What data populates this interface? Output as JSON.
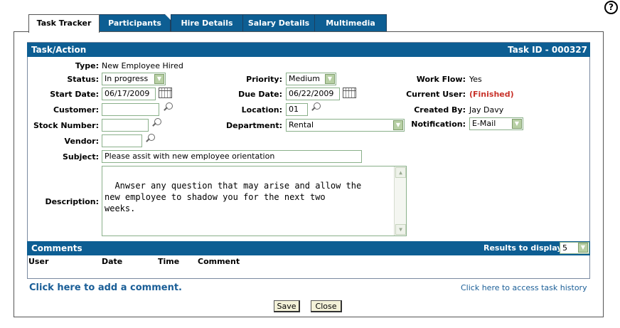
{
  "help": {
    "icon": "question-circle-icon",
    "glyph": "?"
  },
  "tabs": [
    {
      "label": "Task Tracker",
      "active": true
    },
    {
      "label": "Participants"
    },
    {
      "label": "Hire Details"
    },
    {
      "label": "Salary Details"
    },
    {
      "label": "Multimedia"
    }
  ],
  "task": {
    "header": "Task/Action",
    "task_id": "Task ID - 000327",
    "type_label": "Type:",
    "type_value": "New Employee Hired",
    "status_label": "Status:",
    "status_value": "In progress",
    "start_label": "Start Date:",
    "start_value": "06/17/2009",
    "customer_label": "Customer:",
    "customer_value": "",
    "stock_label": "Stock Number:",
    "stock_value": "",
    "vendor_label": "Vendor:",
    "vendor_value": "",
    "subject_label": "Subject:",
    "subject_value": "Please assit with new employee orientation",
    "description_label": "Description:",
    "description_value": "Anwser any question that may arise and allow the\nnew employee to shadow you for the next two\nweeks.",
    "priority_label": "Priority:",
    "priority_value": "Medium",
    "due_label": "Due Date:",
    "due_value": "06/22/2009",
    "location_label": "Location:",
    "location_value": "01",
    "department_label": "Department:",
    "department_value": "Rental",
    "workflow_label": "Work Flow:",
    "workflow_value": "Yes",
    "current_user_label": "Current User:",
    "current_user_value": "(Finished)",
    "created_by_label": "Created By:",
    "created_by_value": "Jay Davy",
    "notification_label": "Notification:",
    "notification_value": "E-Mail"
  },
  "comments": {
    "header": "Comments",
    "results_label": "Results to display:",
    "results_value": "5",
    "columns": [
      "User",
      "Date",
      "Time",
      "Comment"
    ]
  },
  "links": {
    "add_comment": "Click here to add a comment.",
    "task_history": "Click here to access task history"
  },
  "buttons": {
    "save": "Save",
    "close": "Close"
  },
  "colors": {
    "header_blue": "#0d5e93",
    "link_blue": "#1a5e97",
    "finished_red": "#c8322a"
  }
}
